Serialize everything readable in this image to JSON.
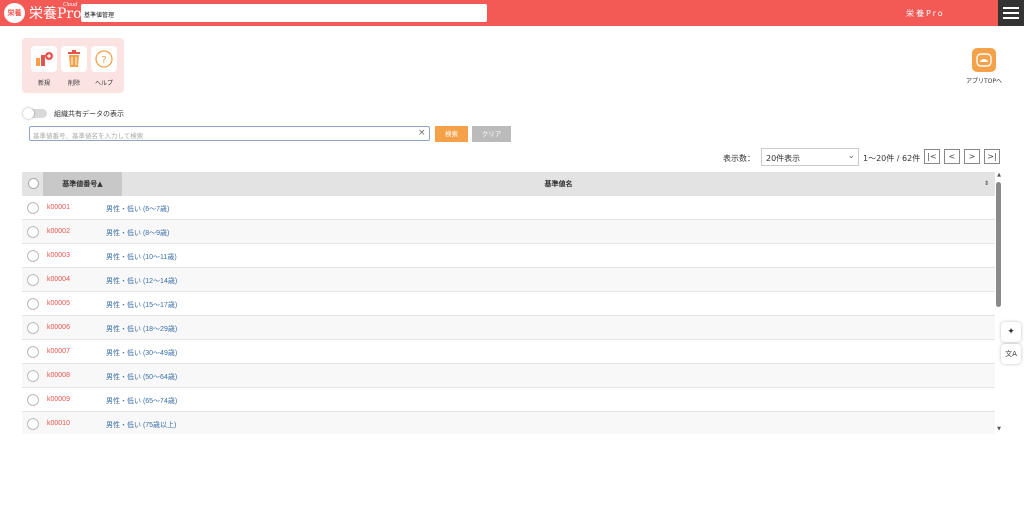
{
  "header": {
    "logo_badge": "栄養",
    "logo_text": "栄養Pro",
    "logo_cloud": "Cloud",
    "page_title": "基準値管理",
    "user_name": "栄養Pro",
    "brand_color": "#f45a55"
  },
  "toolbar": {
    "new_label": "新規",
    "delete_label": "削除",
    "help_label": "ヘルプ",
    "app_top_label": "アプリTOPへ"
  },
  "filter": {
    "share_toggle_label": "組織共有データの表示",
    "search_placeholder": "基準値番号、基準値名を入力して検索",
    "search_clear": "×",
    "search_button": "検索",
    "clear_button": "クリア"
  },
  "pager": {
    "display_label": "表示数：",
    "display_value": "20件表示",
    "count_text": "1〜20件 / 62件",
    "first": "|<",
    "prev": "<",
    "next": ">",
    "last": ">|"
  },
  "table": {
    "col_code": "基準値番号▲",
    "col_name": "基準値名",
    "sort_icon": "⇕",
    "rows": [
      {
        "code": "k00001",
        "name": "男性・低い (6〜7歳)"
      },
      {
        "code": "k00002",
        "name": "男性・低い (8〜9歳)"
      },
      {
        "code": "k00003",
        "name": "男性・低い (10〜11歳)"
      },
      {
        "code": "k00004",
        "name": "男性・低い (12〜14歳)"
      },
      {
        "code": "k00005",
        "name": "男性・低い (15〜17歳)"
      },
      {
        "code": "k00006",
        "name": "男性・低い (18〜29歳)"
      },
      {
        "code": "k00007",
        "name": "男性・低い (30〜49歳)"
      },
      {
        "code": "k00008",
        "name": "男性・低い (50〜64歳)"
      },
      {
        "code": "k00009",
        "name": "男性・低い (65〜74歳)"
      },
      {
        "code": "k00010",
        "name": "男性・低い (75歳以上)"
      }
    ]
  },
  "side": {
    "ai_icon": "✦",
    "translate_icon": "文A"
  }
}
